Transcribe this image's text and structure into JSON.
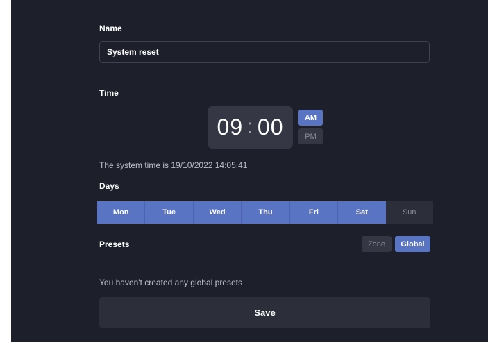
{
  "form": {
    "name_label": "Name",
    "name_value": "System reset",
    "time_label": "Time",
    "hours": "09",
    "separator": ":",
    "minutes": "00",
    "am_label": "AM",
    "pm_label": "PM",
    "selected_period": "AM",
    "system_time": "The system time is 19/10/2022 14:05:41",
    "days_label": "Days",
    "days": [
      {
        "label": "Mon",
        "selected": true
      },
      {
        "label": "Tue",
        "selected": true
      },
      {
        "label": "Wed",
        "selected": true
      },
      {
        "label": "Thu",
        "selected": true
      },
      {
        "label": "Fri",
        "selected": true
      },
      {
        "label": "Sat",
        "selected": true
      },
      {
        "label": "Sun",
        "selected": false
      }
    ],
    "presets_label": "Presets",
    "preset_tabs": [
      {
        "label": "Zone",
        "selected": false
      },
      {
        "label": "Global",
        "selected": true
      }
    ],
    "empty_presets_message": "You haven't created any global presets",
    "save_label": "Save"
  },
  "colors": {
    "background": "#1d1f2a",
    "accent": "#5874c3",
    "surface": "#353744"
  }
}
